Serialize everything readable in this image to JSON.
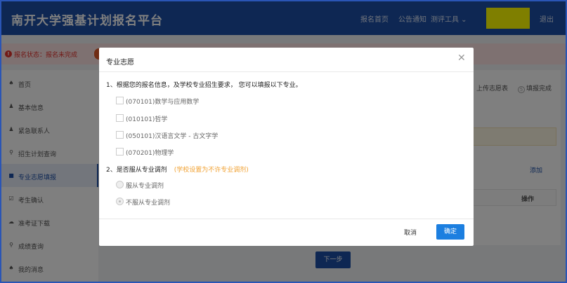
{
  "header": {
    "brand": "南开大学强基计划报名平台",
    "nav": [
      "报名首页",
      "公告通知"
    ],
    "nav_dropdown": "测评工具 ⌄",
    "logout": "退出"
  },
  "status": {
    "text": "报名状态：报名未完成"
  },
  "sidebar": {
    "items": [
      {
        "icon": "home-icon",
        "glyph": "♠",
        "label": "首页"
      },
      {
        "icon": "user-icon",
        "glyph": "♟",
        "label": "基本信息"
      },
      {
        "icon": "contact-icon",
        "glyph": "♟",
        "label": "紧急联系人"
      },
      {
        "icon": "search-icon",
        "glyph": "⚲",
        "label": "招生计划查询"
      },
      {
        "icon": "list-icon",
        "glyph": "■",
        "label": "专业志愿填报"
      },
      {
        "icon": "check-icon",
        "glyph": "☑",
        "label": "考生确认"
      },
      {
        "icon": "download-icon",
        "glyph": "☁",
        "label": "准考证下载"
      },
      {
        "icon": "score-search-icon",
        "glyph": "⚲",
        "label": "成绩查询"
      },
      {
        "icon": "bell-icon",
        "glyph": "♠",
        "label": "我的消息"
      }
    ]
  },
  "main": {
    "steps": [
      {
        "label": "上传志愿表"
      },
      {
        "num": "5",
        "label": "填报完成"
      }
    ],
    "add_link": "添加",
    "table_header_ops": "操作",
    "next_button": "下一步"
  },
  "modal": {
    "title": "专业志愿",
    "close_glyph": "✕",
    "question1": "1、根据您的报名信息，及学校专业招生要求， 您可以填报以下专业。",
    "majors": [
      "(070101)数学与应用数学",
      "(010101)哲学",
      "(050101)汉语言文学 - 古文字学",
      "(070201)物理学"
    ],
    "question2": "2、是否服从专业调剂",
    "question2_note": "(学校设置为不许专业调剂)",
    "radio_options": [
      {
        "label": "服从专业调剂",
        "checked": false
      },
      {
        "label": "不服从专业调剂",
        "checked": true
      }
    ],
    "cancel_label": "取消",
    "ok_label": "确定"
  }
}
